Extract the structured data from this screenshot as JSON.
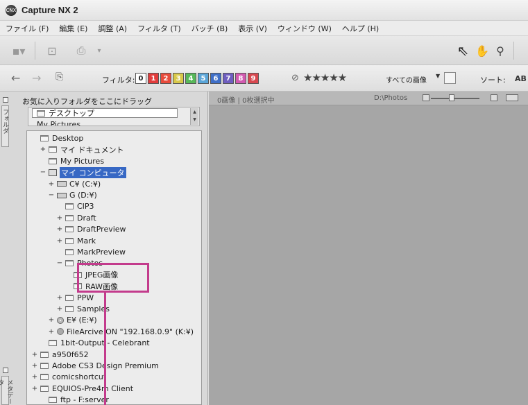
{
  "window": {
    "title": "Capture NX 2",
    "logo_text": "CNX"
  },
  "menu": [
    "ファイル (F)",
    "編集 (E)",
    "調整 (A)",
    "フィルタ (T)",
    "バッチ (B)",
    "表示 (V)",
    "ウィンドウ (W)",
    "ヘルプ (H)"
  ],
  "toolbar": {
    "filter_label": "フィルタ:",
    "filters": [
      {
        "label": "0",
        "color": "#ffffff"
      },
      {
        "label": "1",
        "color": "#e23b3b"
      },
      {
        "label": "2",
        "color": "#e84b3c"
      },
      {
        "label": "3",
        "color": "#d8c84a"
      },
      {
        "label": "4",
        "color": "#58b85a"
      },
      {
        "label": "5",
        "color": "#5aa5d8"
      },
      {
        "label": "6",
        "color": "#3f6fc8"
      },
      {
        "label": "7",
        "color": "#6f5ec0"
      },
      {
        "label": "8",
        "color": "#d25ab0"
      },
      {
        "label": "9",
        "color": "#d84850"
      }
    ],
    "rating": "★★★★★",
    "view_filter": "すべての画像",
    "sort_label": "ソート:",
    "sort_value": "AB"
  },
  "left_panel": {
    "folders_tab": "フォルダ",
    "metadata_tab": "メタデータ",
    "favorites_label": "お気に入りフォルダをここにドラッグ",
    "favorites": [
      "デスクトップ",
      "My Pictures"
    ],
    "tree": [
      {
        "label": "Desktop",
        "indent": 0,
        "exp": "",
        "icon": "folder"
      },
      {
        "label": "マイ ドキュメント",
        "indent": 1,
        "exp": "+",
        "icon": "folder"
      },
      {
        "label": "My Pictures",
        "indent": 1,
        "exp": "",
        "icon": "folder"
      },
      {
        "label": "マイ コンピュータ",
        "indent": 1,
        "exp": "−",
        "icon": "computer",
        "selected": true
      },
      {
        "label": "C¥ (C:¥)",
        "indent": 2,
        "exp": "+",
        "icon": "drive"
      },
      {
        "label": "G (D:¥)",
        "indent": 2,
        "exp": "−",
        "icon": "drive"
      },
      {
        "label": "CIP3",
        "indent": 3,
        "exp": "",
        "icon": "folder"
      },
      {
        "label": "Draft",
        "indent": 3,
        "exp": "+",
        "icon": "folder"
      },
      {
        "label": "DraftPreview",
        "indent": 3,
        "exp": "+",
        "icon": "folder"
      },
      {
        "label": "Mark",
        "indent": 3,
        "exp": "+",
        "icon": "folder"
      },
      {
        "label": "MarkPreview",
        "indent": 3,
        "exp": "",
        "icon": "folder"
      },
      {
        "label": "Photos",
        "indent": 3,
        "exp": "−",
        "icon": "folder"
      },
      {
        "label": "JPEG画像",
        "indent": 4,
        "exp": "",
        "icon": "folder"
      },
      {
        "label": "RAW画像",
        "indent": 4,
        "exp": "",
        "icon": "folder"
      },
      {
        "label": "PPW",
        "indent": 3,
        "exp": "+",
        "icon": "folder"
      },
      {
        "label": "Samples",
        "indent": 3,
        "exp": "+",
        "icon": "folder"
      },
      {
        "label": "E¥ (E:¥)",
        "indent": 2,
        "exp": "+",
        "icon": "cd"
      },
      {
        "label": "FileArcive ON \"192.168.0.9\" (K:¥)",
        "indent": 2,
        "exp": "+",
        "icon": "net"
      },
      {
        "label": "1bit-Output - Celebrant",
        "indent": 1,
        "exp": "",
        "icon": "folder"
      },
      {
        "label": "a950f652",
        "indent": 0,
        "exp": "+",
        "icon": "folder"
      },
      {
        "label": "Adobe CS3 Design Premium",
        "indent": 0,
        "exp": "+",
        "icon": "folder"
      },
      {
        "label": "comicshortcut",
        "indent": 0,
        "exp": "+",
        "icon": "folder"
      },
      {
        "label": "EQUIOS-Pre4m Client",
        "indent": 0,
        "exp": "+",
        "icon": "folder"
      },
      {
        "label": "ftp - F:server",
        "indent": 1,
        "exp": "",
        "icon": "folder"
      }
    ]
  },
  "main": {
    "status": "0画像 | 0枚選択中",
    "path": "D:\\Photos"
  }
}
